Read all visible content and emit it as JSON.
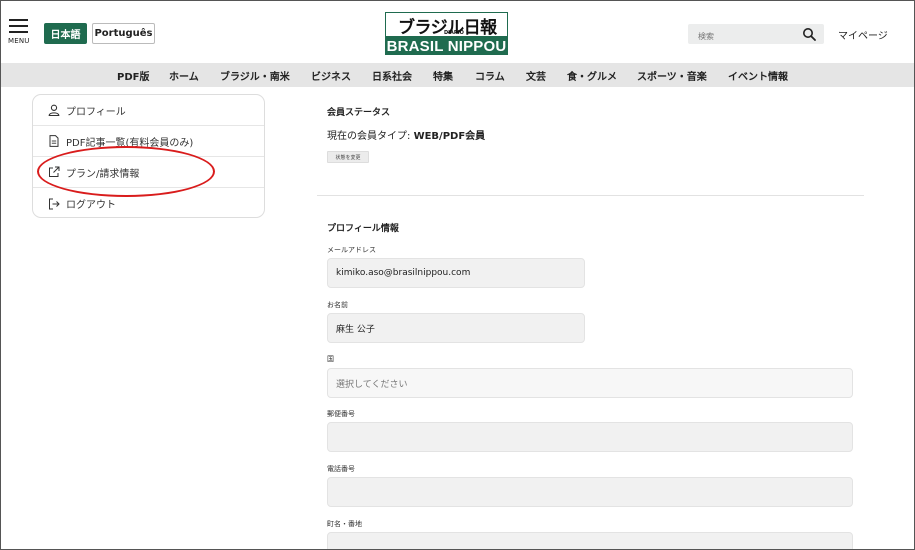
{
  "header": {
    "menu_label": "MENU",
    "lang_ja": "日本語",
    "lang_pt": "Português",
    "logo_top": "ブラジル日報",
    "logo_diario": "DIÁRIO",
    "logo_bottom": "BRASIL NIPPOU",
    "search_placeholder": "検索",
    "mypage": "マイページ",
    "accent_color": "#1f6b4f"
  },
  "nav": {
    "items": [
      "PDF版",
      "ホーム",
      "ブラジル・南米",
      "ビジネス",
      "日系社会",
      "特集",
      "コラム",
      "文芸",
      "食・グルメ",
      "スポーツ・音楽",
      "イベント情報"
    ]
  },
  "sidebar": {
    "items": [
      {
        "label": "プロフィール",
        "icon": "user-icon"
      },
      {
        "label": "PDF記事一覧(有料会員のみ)",
        "icon": "document-icon"
      },
      {
        "label": "プラン/請求情報",
        "icon": "external-link-icon"
      },
      {
        "label": "ログアウト",
        "icon": "logout-icon"
      }
    ]
  },
  "membership": {
    "title": "会員ステータス",
    "type_prefix": "現在の会員タイプ: ",
    "type_value": "WEB/PDF会員",
    "change_button": "状態を変更"
  },
  "profile": {
    "title": "プロフィール情報",
    "email_label": "メールアドレス",
    "email_value": "kimiko.aso@brasilnippou.com",
    "name_label": "お名前",
    "name_value": "麻生 公子",
    "country_label": "国",
    "country_placeholder": "選択してください",
    "postal_label": "郵便番号",
    "postal_value": "",
    "phone_label": "電話番号",
    "phone_value": "",
    "address_label": "町名・番地",
    "address_value": ""
  }
}
